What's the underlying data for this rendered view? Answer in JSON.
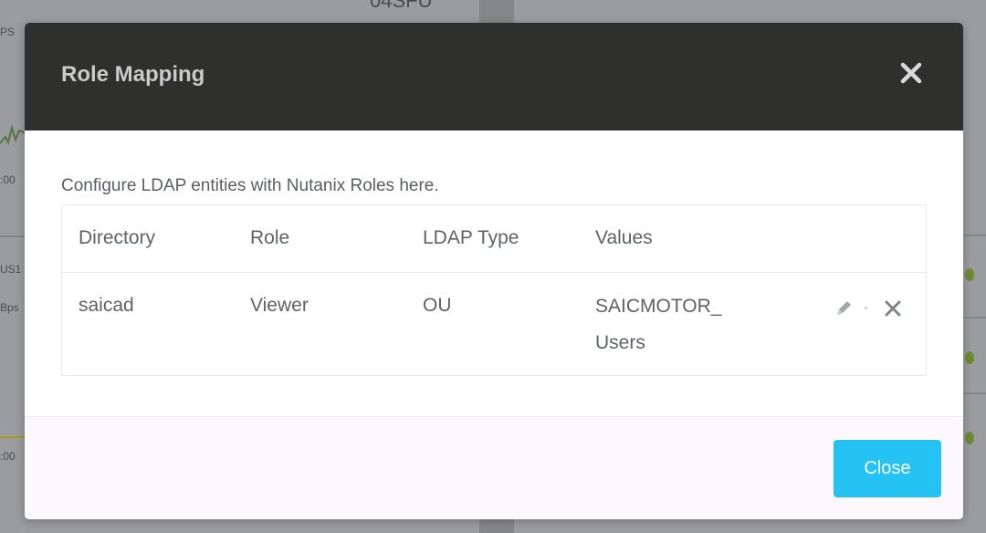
{
  "background": {
    "top_text": "04SFU",
    "left_labels": [
      "PS",
      ":00",
      "US1",
      "Bps",
      ":00"
    ]
  },
  "dialog": {
    "title": "Role Mapping",
    "close_icon": "close-icon",
    "description": "Configure LDAP entities with Nutanix Roles here.",
    "table": {
      "headers": [
        "Directory",
        "Role",
        "LDAP Type",
        "Values"
      ],
      "rows": [
        {
          "directory": "saicad",
          "role": "Viewer",
          "ldap_type": "OU",
          "values_line1": "SAICMOTOR_",
          "values_line2": "Users",
          "actions": [
            "edit-icon",
            "delete-icon"
          ]
        }
      ]
    },
    "footer": {
      "close_label": "Close"
    }
  },
  "colors": {
    "header_bg": "#2f302d",
    "title_color": "#c8cacc",
    "primary_button": "#25c3f3",
    "text_color": "#5f6266"
  }
}
